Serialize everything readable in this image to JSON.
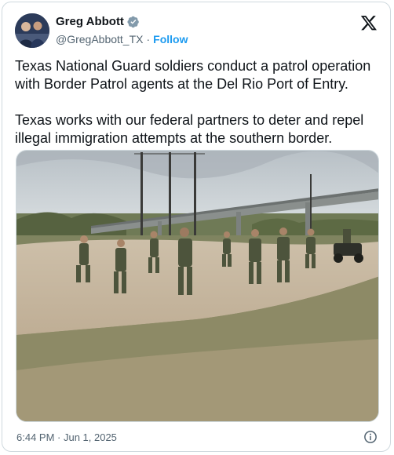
{
  "author": {
    "name": "Greg Abbott",
    "handle": "@GregAbbott_TX",
    "separator": "·",
    "follow_label": "Follow",
    "verified": true
  },
  "tweet": {
    "paragraph_1": "Texas National Guard soldiers conduct a patrol operation with Border Patrol agents at the Del Rio Port of Entry.",
    "paragraph_2": "Texas works with our federal partners to deter and repel illegal immigration attempts at the southern border."
  },
  "footer": {
    "timestamp": "6:44 PM · Jun 1, 2025"
  },
  "icons": {
    "verified": "verified-badge-icon",
    "platform": "x-logo-icon",
    "info": "info-icon"
  },
  "colors": {
    "accent": "#1d9bf0",
    "secondary_text": "#536471",
    "border": "#cfd9de"
  }
}
